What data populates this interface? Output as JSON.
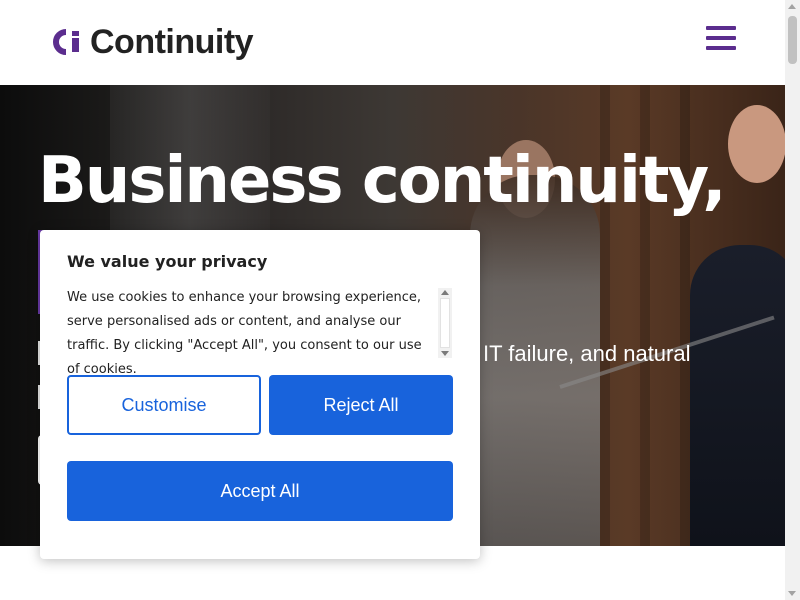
{
  "header": {
    "logo_text": "Continuity",
    "logo_mark": "Ci",
    "menu_icon": "hamburger-menu-icon",
    "brand_color": "#5b2d8e"
  },
  "hero": {
    "title": "Business continuity,",
    "subtitle_fragment": "IT failure, and natural"
  },
  "cookie_banner": {
    "title": "We value your privacy",
    "text": "We use cookies to enhance your browsing experience, serve personalised ads or content, and analyse our traffic. By clicking \"Accept All\", you consent to our use of cookies.",
    "customise_label": "Customise",
    "reject_label": "Reject All",
    "accept_label": "Accept All",
    "accent_color": "#1863dc"
  }
}
